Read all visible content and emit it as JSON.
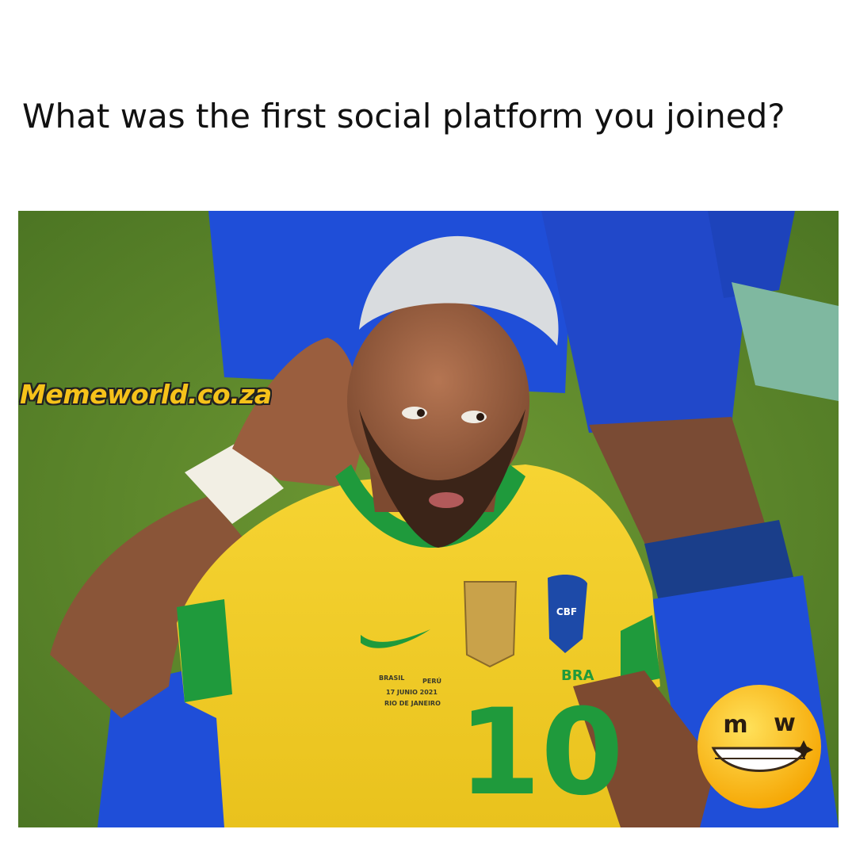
{
  "caption": "What was the first social platform you joined?",
  "watermark": "Memeworld.co.za",
  "photo": {
    "icon": "soccer-player-cupping-ear-photo",
    "jersey_number": "10",
    "jersey_text": {
      "line1": "BRASIL",
      "line1b": "PERÚ",
      "line2": "17 JUNIO 2021",
      "line3": "RIO DE JANEIRO"
    },
    "crest_text": "CBF",
    "sleeve_text": "BRA"
  },
  "logo": {
    "icon": "memeworld-grin-logo",
    "letters": "m w"
  },
  "colors": {
    "background": "#ffffff",
    "jersey_yellow": "#f3cf2a",
    "trim_green": "#1f9a3c",
    "kit_blue": "#1f4ed8",
    "grass": "#5f8a2a",
    "watermark_fill": "#f6c21a",
    "logo_yellow": "#f5b800"
  }
}
